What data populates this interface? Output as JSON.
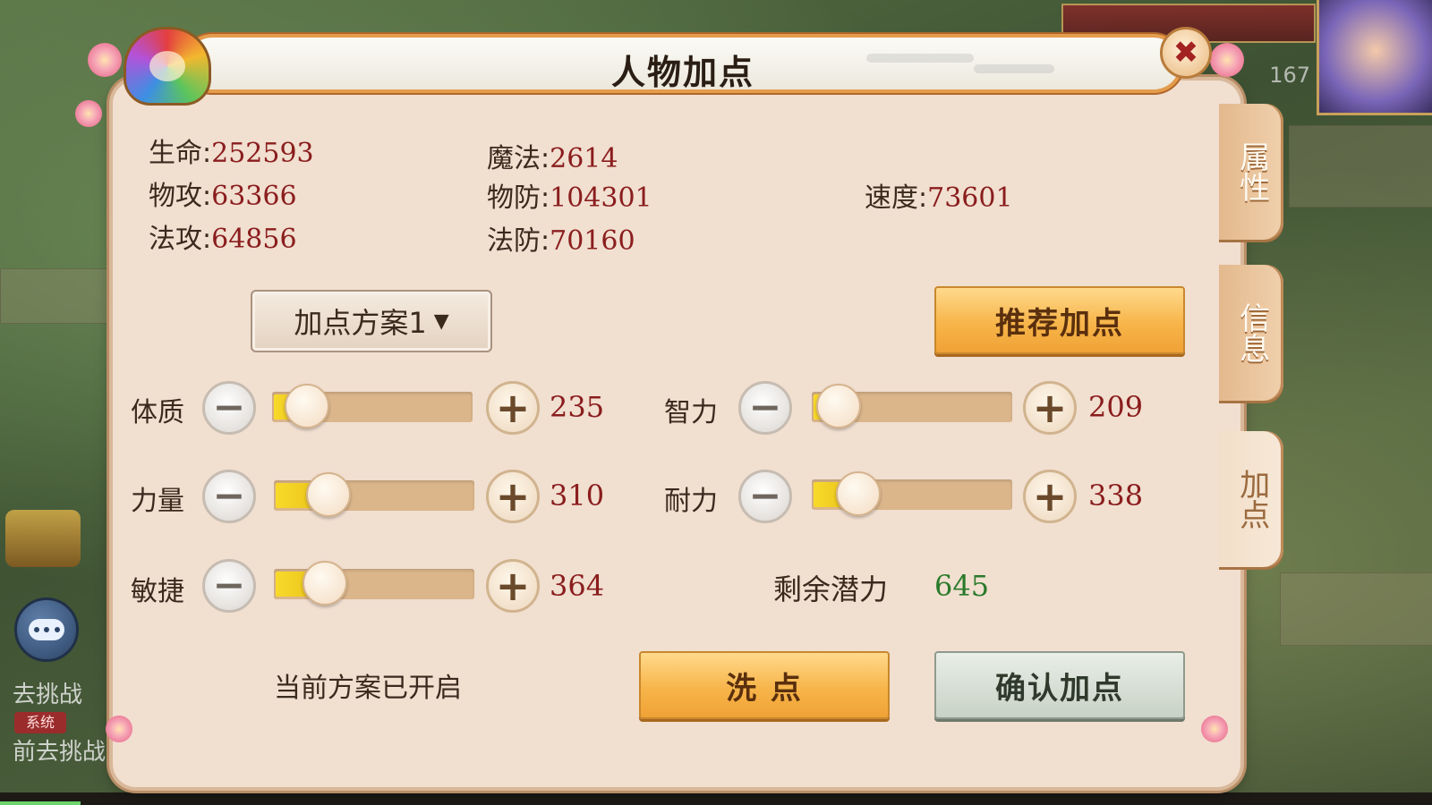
{
  "dialog": {
    "title": "人物加点",
    "close_icon": "✖"
  },
  "side_tabs": [
    {
      "label": "属性",
      "active": false
    },
    {
      "label": "信息",
      "active": false
    },
    {
      "label": "加点",
      "active": true
    }
  ],
  "stats": {
    "hp": {
      "label": "生命:",
      "value": "252593"
    },
    "mp": {
      "label": "魔法:",
      "value": "2614"
    },
    "phys_atk": {
      "label": "物攻:",
      "value": "63366"
    },
    "phys_def": {
      "label": "物防:",
      "value": "104301"
    },
    "speed": {
      "label": "速度:",
      "value": "73601"
    },
    "mag_atk": {
      "label": "法攻:",
      "value": "64856"
    },
    "mag_def": {
      "label": "法防:",
      "value": "70160"
    }
  },
  "plan_select": {
    "label": "加点方案1",
    "arrow": "▼"
  },
  "recommend_button": "推荐加点",
  "attributes": {
    "constitution": {
      "label": "体质",
      "value": "235",
      "fill": 0.08
    },
    "intellect": {
      "label": "智力",
      "value": "209",
      "fill": 0.04
    },
    "strength": {
      "label": "力量",
      "value": "310",
      "fill": 0.18
    },
    "endurance": {
      "label": "耐力",
      "value": "338",
      "fill": 0.14
    },
    "agility": {
      "label": "敏捷",
      "value": "364",
      "fill": 0.16
    }
  },
  "remaining": {
    "label": "剩余潜力",
    "value": "645"
  },
  "plan_status": "当前方案已开启",
  "reset_button": "洗 点",
  "confirm_button": "确认加点",
  "background": {
    "task1": "去挑战",
    "task2": "前去挑战",
    "sys_tag": "系统",
    "hud_number": "167"
  },
  "colors": {
    "stat_value": "#8a1d1d",
    "remaining_value": "#2a7a2a",
    "gold_button": "#f7b54a",
    "panel_bg": "#f1dfd0"
  }
}
